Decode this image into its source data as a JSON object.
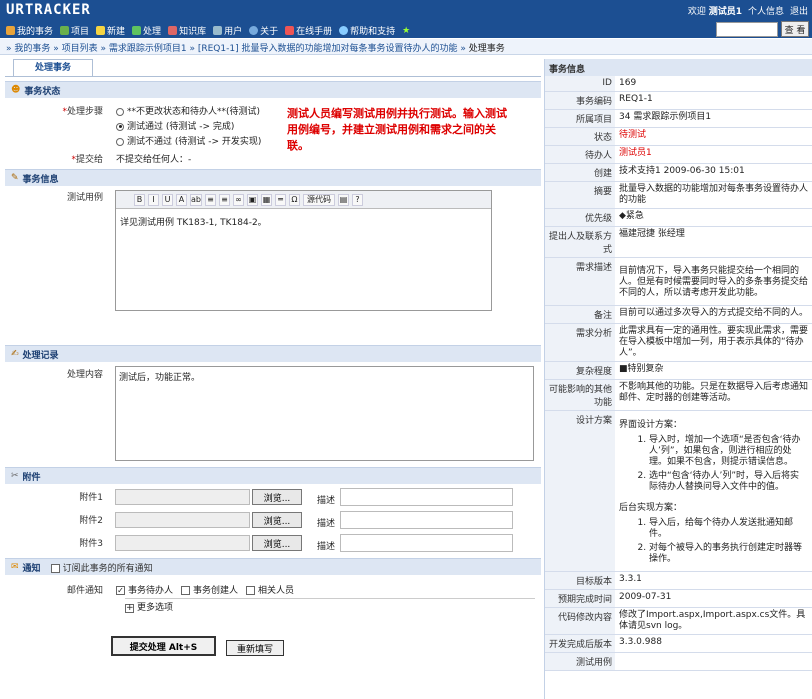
{
  "header": {
    "logo": "URTRACKER",
    "nav": [
      "我的事务",
      "项目",
      "新建",
      "处理",
      "知识库",
      "用户",
      "关于",
      "在线手册",
      "帮助和支持"
    ],
    "welcome": "欢迎",
    "user": "测试员1",
    "profile": "个人信息",
    "logout": "退出",
    "search_btn": "查 看"
  },
  "breadcrumb": [
    "我的事务",
    "项目列表",
    "需求跟踪示例项目1",
    "[REQ1-1] 批量导入数据的功能增加对每条事务设置待办人的功能"
  ],
  "breadcrumb_last": "处理事务",
  "tab": "处理事务",
  "status": {
    "title": "事务状态",
    "step_label": "处理步骤",
    "req": "*",
    "options": [
      "**不更改状态和待办人**(待测试)",
      "测试通过 (待测试 -> 完成)",
      "测试不通过 (待测试 -> 开发实现)"
    ],
    "submit_label": "提交给",
    "submit_value": "不提交给任何人：-"
  },
  "note": "测试人员编写测试用例并执行测试。输入测试用例编号，并建立测试用例和需求之间的关联。",
  "info": {
    "title": "事务信息",
    "testcase_label": "测试用例",
    "toolbar": [
      "B",
      "I",
      "U",
      "A",
      "ab",
      "≡",
      "≡",
      "∞",
      "▣",
      "▦",
      "═",
      "Ω",
      "源代码",
      "▤",
      "?"
    ],
    "content": "详见测试用例 TK183-1, TK184-2。"
  },
  "record": {
    "title": "处理记录",
    "label": "处理内容",
    "content": "测试后，功能正常。"
  },
  "attach": {
    "title": "附件",
    "labels": [
      "附件1",
      "附件2",
      "附件3"
    ],
    "browse": "浏览...",
    "desc": "描述"
  },
  "notify": {
    "title": "通知",
    "subscribe": "订阅此事务的所有通知",
    "mail_label": "邮件通知",
    "opts": [
      "事务待办人",
      "事务创建人",
      "相关人员"
    ],
    "more": "更多选项"
  },
  "buttons": {
    "submit": "提交处理 Alt+S",
    "reset": "重新填写"
  },
  "right": {
    "title": "事务信息",
    "rows": [
      [
        "ID",
        "169"
      ],
      [
        "事务编码",
        "REQ1-1"
      ],
      [
        "所属项目",
        "34 需求跟踪示例项目1"
      ],
      [
        "状态",
        "待测试"
      ],
      [
        "待办人",
        "测试员1"
      ],
      [
        "创建",
        "技术支持1 2009-06-30 15:01"
      ],
      [
        "摘要",
        "批量导入数据的功能增加对每条事务设置待办人的功能"
      ],
      [
        "优先级",
        "◆紧急"
      ],
      [
        "提出人及联系方式",
        "福建冠捷 张经理"
      ],
      [
        "需求描述",
        "目前情况下，导入事务只能提交给一个相同的人。但是有时候需要同时导入的多条事务提交给不同的人，所以请考虑开发此功能。"
      ],
      [
        "备注",
        "目前可以通过多次导入的方式提交给不同的人。"
      ],
      [
        "需求分析",
        "此需求具有一定的通用性。要实现此需求，需要在导入模板中增加一列，用于表示具体的“待办人”。"
      ],
      [
        "复杂程度",
        "■特别复杂"
      ],
      [
        "可能影响的其他功能",
        "不影响其他的功能。只是在数据导入后考虑通知邮件、定时器的创建等活动。"
      ]
    ],
    "design_label": "设计方案",
    "design_ui": "界面设计方案：",
    "design_ui_list": [
      "导入时，增加一个选项“是否包含‘待办人’列”，如果包含，则进行相应的处理。如果不包含，则提示错误信息。",
      "选中“包含‘待办人’列”时，导入后将实际待办人替换问导入文件中的值。"
    ],
    "design_bg": "后台实现方案：",
    "design_bg_list": [
      "导入后，给每个待办人发送批通知邮件。",
      "对每个被导入的事务执行创建定时器等操作。"
    ],
    "rows2": [
      [
        "目标版本",
        "3.3.1"
      ],
      [
        "预期完成时间",
        "2009-07-31"
      ],
      [
        "代码修改内容",
        "修改了Import.aspx,Import.aspx.cs文件。具体请见svn log。"
      ],
      [
        "开发完成后版本",
        "3.3.0.988"
      ],
      [
        "测试用例",
        ""
      ]
    ]
  }
}
